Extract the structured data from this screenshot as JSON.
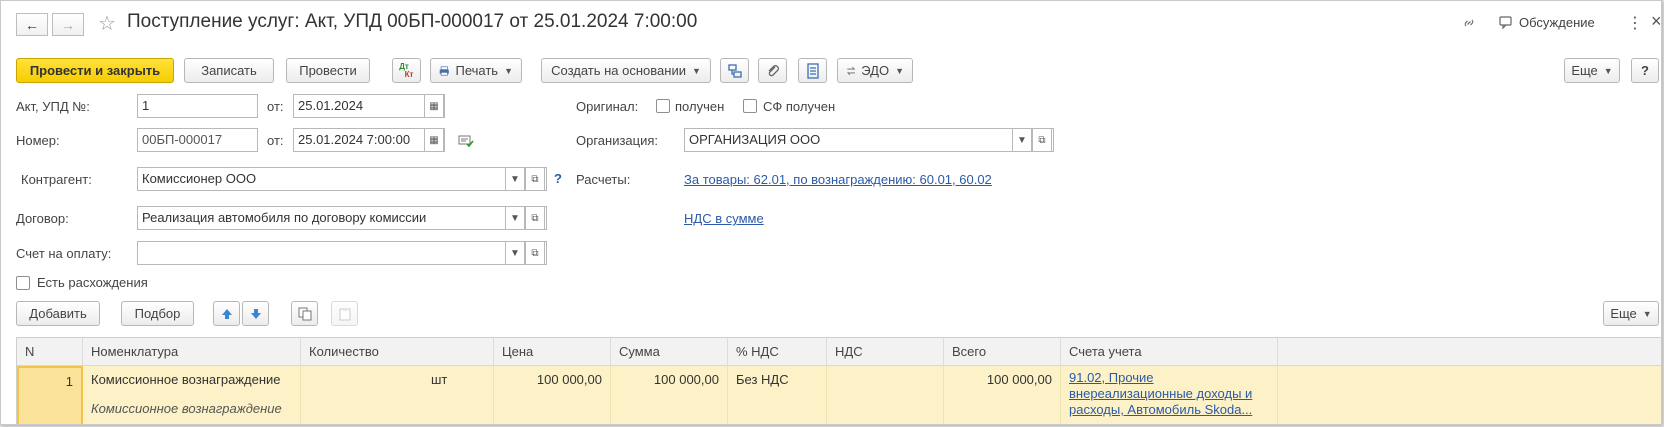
{
  "window": {
    "title": "Поступление услуг: Акт, УПД 00БП-000017 от 25.01.2024 7:00:00",
    "discussion_label": "Обсуждение",
    "nav_back": "←",
    "nav_forward": "→",
    "star": "☆",
    "link_glyph": "🔗",
    "more_glyph": "⋮",
    "close_glyph": "×"
  },
  "toolbar": {
    "post_and_close": "Провести и закрыть",
    "save": "Записать",
    "post": "Провести",
    "dtkt_top": "Дт",
    "dtkt_bottom": "Кт",
    "print": "Печать",
    "create_based_on": "Создать на основании",
    "edo": "ЭДО",
    "more": "Еще",
    "help": "?"
  },
  "form": {
    "act_label": "Акт, УПД №:",
    "act_value": "1",
    "from_label": "от:",
    "act_date": "25.01.2024",
    "number_label": "Номер:",
    "number_value": "00БП-000017",
    "number_date": "25.01.2024  7:00:00",
    "original_label": "Оригинал:",
    "received_label": "получен",
    "sf_received_label": "СФ получен",
    "organization_label": "Организация:",
    "organization_value": "ОРГАНИЗАЦИЯ ООО",
    "counterparty_label": "Контрагент:",
    "counterparty_value": "Комиссионер ООО",
    "counterparty_help": "?",
    "settlements_label": "Расчеты:",
    "settlements_link": "За товары: 62.01, по вознаграждению: 60.01, 60.02",
    "contract_label": "Договор:",
    "contract_value": "Реализация автомобиля по договору комиссии",
    "vat_link": "НДС в сумме",
    "invoice_label": "Счет на оплату:",
    "invoice_value": "",
    "discrepancies_label": "Есть расхождения"
  },
  "table_toolbar": {
    "add": "Добавить",
    "select": "Подбор",
    "more": "Еще"
  },
  "table": {
    "headers": [
      "N",
      "Номенклатура",
      "Количество",
      "Цена",
      "Сумма",
      "% НДС",
      "НДС",
      "Всего",
      "Счета учета"
    ],
    "rows": [
      {
        "n": "1",
        "nomenclature": "Комиссионное вознаграждение",
        "nomenclature_sub": "Комиссионное вознаграждение",
        "quantity": "",
        "unit": "шт",
        "price": "100 000,00",
        "sum": "100 000,00",
        "vat_rate": "Без НДС",
        "vat": "",
        "total": "100 000,00",
        "accounts": "91.02, Прочие внереализационные доходы и расходы, Автомобиль Skoda..."
      }
    ]
  },
  "colors": {
    "primary_button": "#f6cd00",
    "row_highlight": "#fdf2c7",
    "link": "#2a5aa8"
  }
}
